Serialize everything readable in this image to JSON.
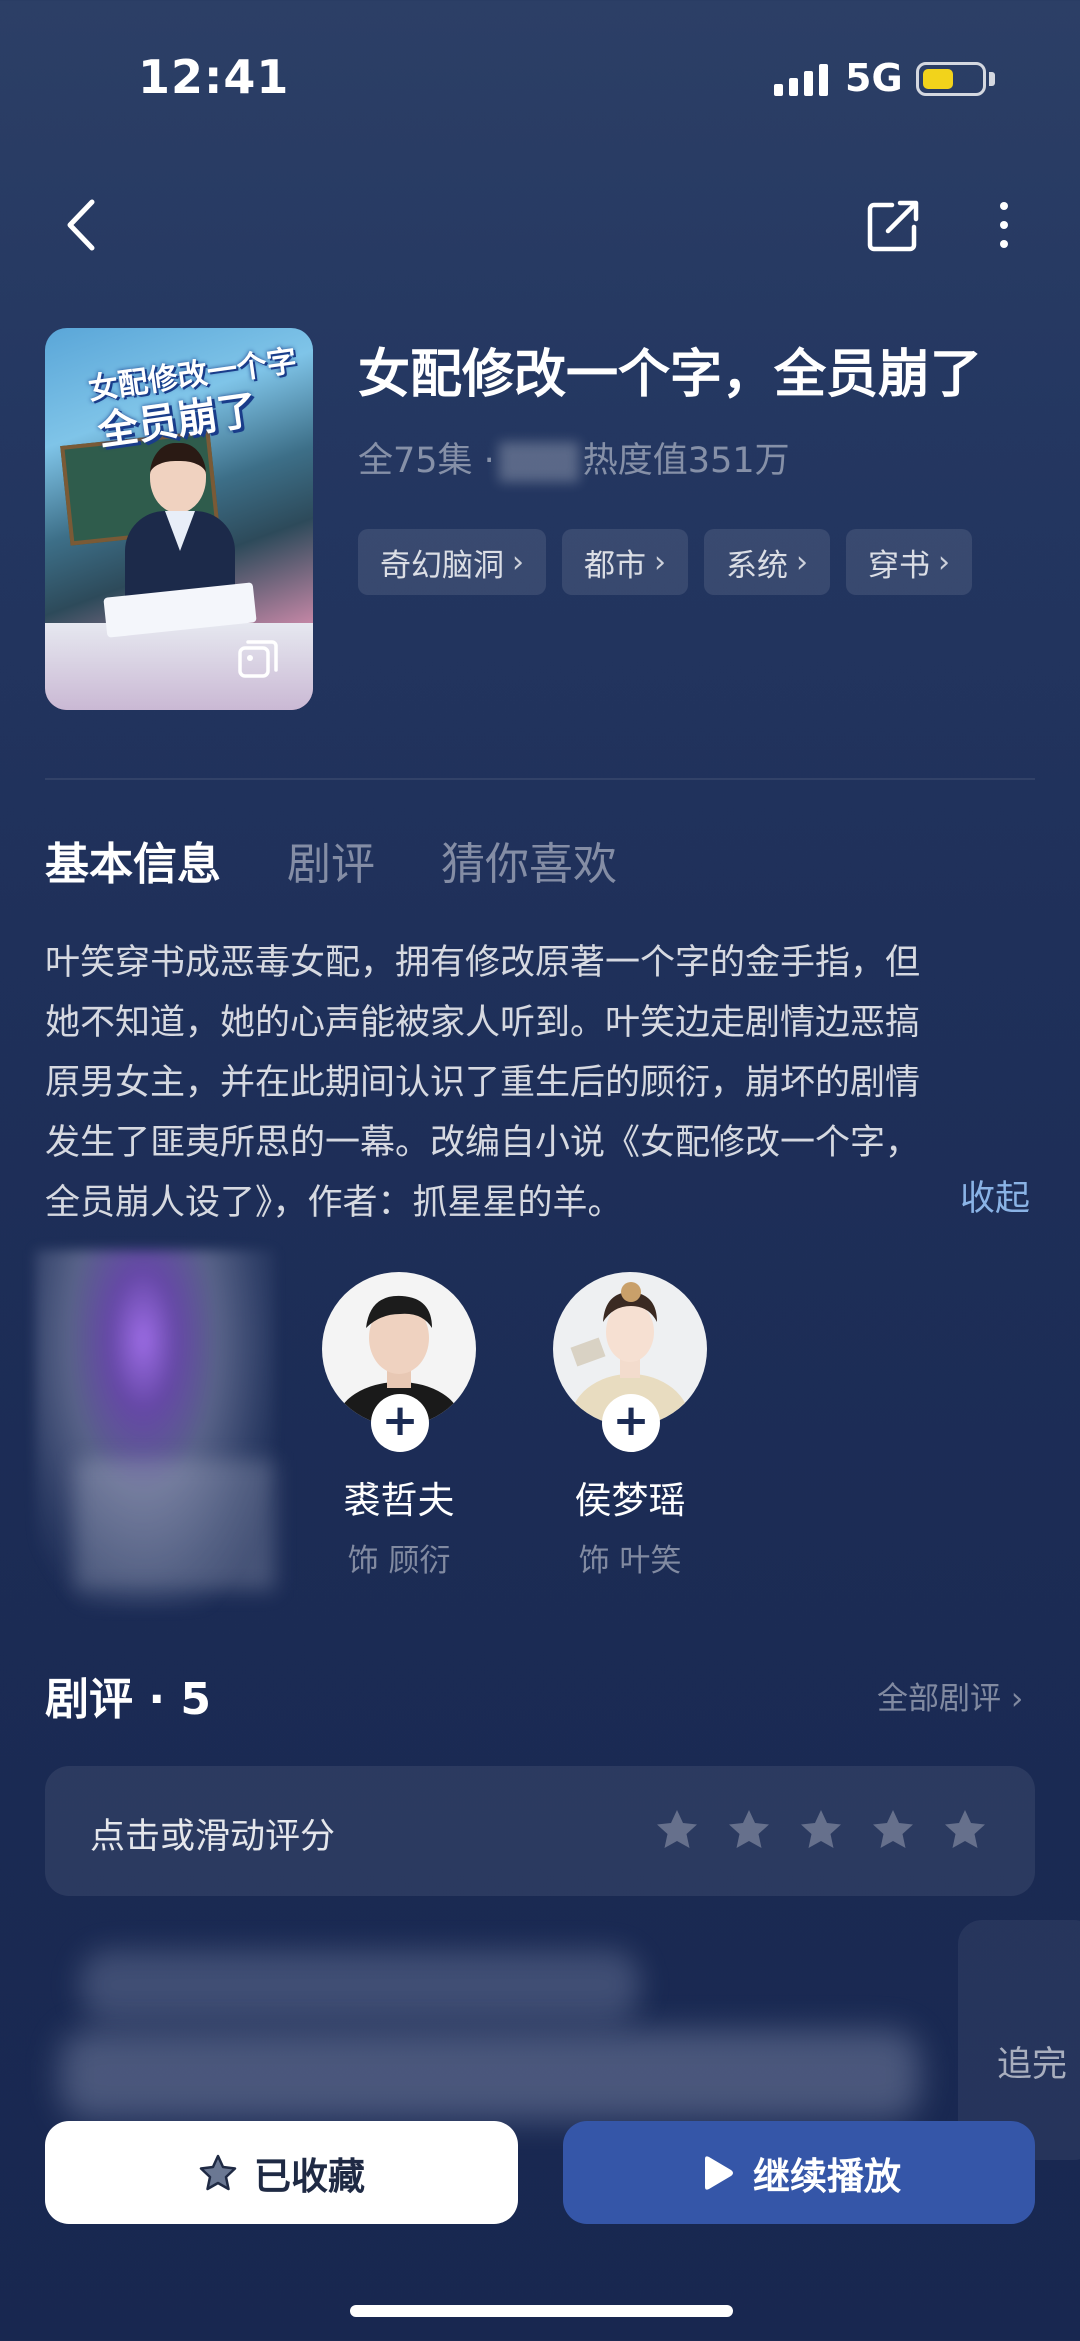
{
  "status_bar": {
    "time": "12:41",
    "network": "5G",
    "battery_color": "#f2d31b"
  },
  "nav": {
    "back_icon": "chevron-left-icon",
    "share_icon": "share-icon",
    "more_icon": "more-vertical-icon"
  },
  "drama": {
    "poster_title_line1": "女配修改一个字",
    "poster_title_line2": "全员崩了",
    "title": "女配修改一个字，全员崩了",
    "meta_episodes": "全75集 ·",
    "meta_heat": "热度值351万",
    "tags": [
      {
        "label": "奇幻脑洞"
      },
      {
        "label": "都市"
      },
      {
        "label": "系统"
      },
      {
        "label": "穿书"
      }
    ]
  },
  "tabs": [
    {
      "label": "基本信息",
      "active": true
    },
    {
      "label": "剧评",
      "active": false
    },
    {
      "label": "猜你喜欢",
      "active": false
    }
  ],
  "synopsis": {
    "lines": [
      "叶笑穿书成恶毒女配，拥有修改原著一个字的金手指，但",
      "她不知道，她的心声能被家人听到。叶笑边走剧情边恶搞",
      "原男女主，并在此期间认识了重生后的顾衍，崩坏的剧情",
      "发生了匪夷所思的一幕。改编自小说《女配修改一个字，",
      "全员崩人设了》，作者：抓星星的羊。"
    ],
    "collapse_label": "收起"
  },
  "cast": [
    {
      "name": "裘哲夫",
      "role": "饰 顾衍"
    },
    {
      "name": "侯梦瑶",
      "role": "饰 叶笑"
    }
  ],
  "reviews": {
    "heading": "剧评 · 5",
    "all_label": "全部剧评",
    "rate_prompt": "点击或滑动评分",
    "star_count": 5,
    "peek_text": "追完"
  },
  "actions": {
    "collect_label": "已收藏",
    "play_label": "继续播放"
  },
  "colors": {
    "accent": "#3556a8",
    "link": "#8ab3e6",
    "background": "#1f305a"
  }
}
